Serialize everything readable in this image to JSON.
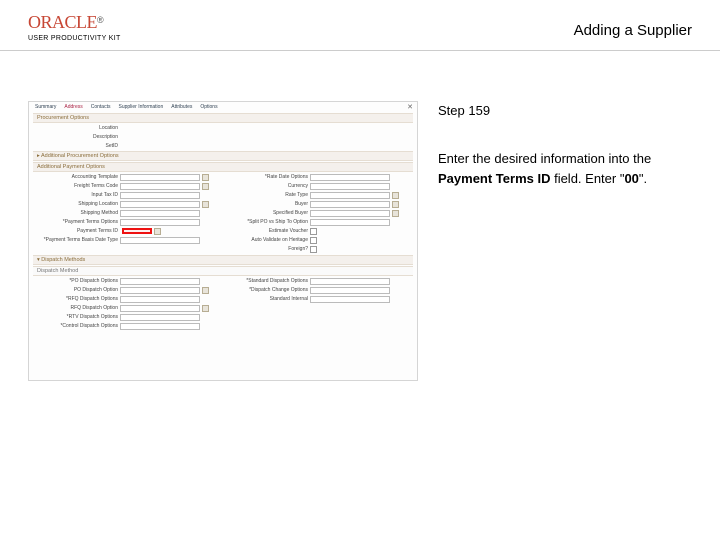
{
  "header": {
    "brand": "ORACLE",
    "brand_tm": "®",
    "sub_brand": "USER PRODUCTIVITY KIT",
    "page_title": "Adding a Supplier"
  },
  "instructions": {
    "step_label": "Step 159",
    "line1": "Enter the desired information into the ",
    "bold1": "Payment Terms ID",
    "mid": " field. Enter \"",
    "bold2": "00",
    "end": "\"."
  },
  "screenshot": {
    "tabs": [
      "Summary",
      "Address",
      "Contacts",
      "Supplier Information",
      "Attributes",
      "Options"
    ],
    "section1": "Procurement Options",
    "section_proc": "▸ Additional Procurement Options",
    "section_pay": "Additional Payment Options",
    "section_disp": "▾ Dispatch Methods",
    "disp_sub": "Dispatch Method",
    "close": "✕",
    "left_top": [
      {
        "label": "Location",
        "val": ""
      },
      {
        "label": "Description",
        "val": ""
      },
      {
        "label": "SetID",
        "val": ""
      }
    ],
    "pay_left": [
      {
        "label": "Accounting Template",
        "field": true,
        "icon": true
      },
      {
        "label": "Freight Terms Code",
        "field": true,
        "icon": true
      },
      {
        "label": "Input Tax ID",
        "field": true
      },
      {
        "label": "Shipping Location",
        "field": true,
        "icon": true
      },
      {
        "label": "Shipping Method",
        "field": true
      },
      {
        "label": "*Payment Terms Options",
        "field": true,
        "highlight": false
      },
      {
        "label": "Payment Terms ID",
        "highlight": true
      },
      {
        "label": "*Payment Terms Basis Date Type",
        "field": true
      }
    ],
    "pay_right": [
      {
        "label": "*Rate Date Options",
        "field": true
      },
      {
        "label": "Currency",
        "field": true
      },
      {
        "label": "Rate Type",
        "field": true,
        "icon": true
      },
      {
        "label": "Buyer",
        "field": true,
        "icon": true
      },
      {
        "label": "Specified Buyer",
        "field": true,
        "icon": true
      },
      {
        "label": "*Split PO vs Ship To Option",
        "field": true
      },
      {
        "label": "Estimate Voucher",
        "check": true
      },
      {
        "label": "Auto Validate on Heritage",
        "check": true
      },
      {
        "label": "Foreign?",
        "check": true
      }
    ],
    "disp_left": [
      {
        "label": "*PO Dispatch Options",
        "field": true
      },
      {
        "label": "PO Dispatch Option",
        "field": true,
        "icon": true
      },
      {
        "label": "*RFQ Dispatch Options",
        "field": true
      },
      {
        "label": "RFQ Dispatch Option",
        "field": true,
        "icon": true
      },
      {
        "label": "*RTV Dispatch Options",
        "field": true
      },
      {
        "label": "*Control Dispatch Options",
        "field": true
      }
    ],
    "disp_right": [
      {
        "label": "*Standard Dispatch Options",
        "field": true
      },
      {
        "label": "*Dispatch Change Options",
        "field": true
      },
      {
        "label": "Standard Internal",
        "field": true
      }
    ]
  }
}
